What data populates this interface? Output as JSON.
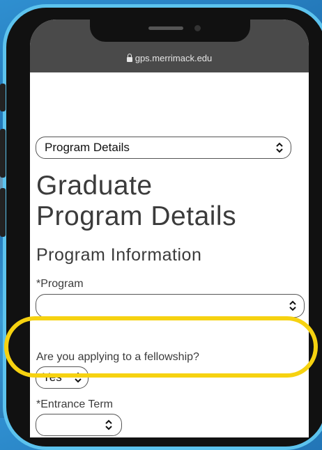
{
  "browser": {
    "url": "gps.merrimack.edu",
    "lock_icon": "lock-icon"
  },
  "form": {
    "section_select": {
      "value": "Program Details"
    },
    "page_title_line1": "Graduate",
    "page_title_line2": "Program Details",
    "section_heading": "Program Information",
    "program_field": {
      "label": "*Program",
      "value": ""
    },
    "fellowship_field": {
      "label": "Are you applying to a fellowship?",
      "value": "Yes"
    },
    "entrance_term_field": {
      "label": "*Entrance Term",
      "value": ""
    }
  },
  "colors": {
    "highlight": "#f6d210",
    "phone_border": "#5cc3ee",
    "status_bar": "#4a4a4a"
  }
}
